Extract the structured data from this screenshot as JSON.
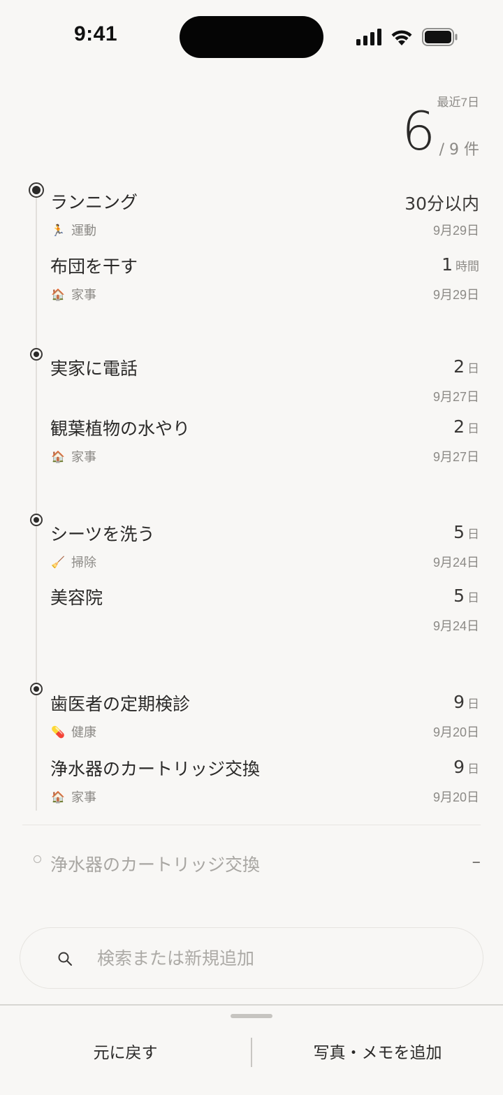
{
  "status_bar": {
    "time": "9:41",
    "icons": [
      "signal-icon",
      "wifi-icon",
      "battery-icon"
    ]
  },
  "summary": {
    "period_label": "最近7日",
    "count": "6",
    "total": "/ 9 件"
  },
  "groups": [
    {
      "items": [
        {
          "title": "ランニング",
          "category": "運動",
          "category_icon": "runner-icon",
          "emoji": "🏃",
          "duration": "30分以内",
          "unit": "",
          "date": "9月29日"
        },
        {
          "title": "布団を干す",
          "category": "家事",
          "category_icon": "house-icon",
          "emoji": "🏠",
          "duration": "1",
          "unit": "時間",
          "date": "9月29日"
        }
      ]
    },
    {
      "items": [
        {
          "title": "実家に電話",
          "category": "",
          "category_icon": "",
          "emoji": "",
          "duration": "2",
          "unit": "日",
          "date": "9月27日"
        },
        {
          "title": "観葉植物の水やり",
          "category": "家事",
          "category_icon": "house-icon",
          "emoji": "🏠",
          "duration": "2",
          "unit": "日",
          "date": "9月27日"
        }
      ]
    },
    {
      "items": [
        {
          "title": "シーツを洗う",
          "category": "掃除",
          "category_icon": "broom-icon",
          "emoji": "🧹",
          "duration": "5",
          "unit": "日",
          "date": "9月24日"
        },
        {
          "title": "美容院",
          "category": "",
          "category_icon": "",
          "emoji": "",
          "duration": "5",
          "unit": "日",
          "date": "9月24日"
        }
      ]
    },
    {
      "items": [
        {
          "title": "歯医者の定期検診",
          "category": "健康",
          "category_icon": "pill-icon",
          "emoji": "💊",
          "duration": "9",
          "unit": "日",
          "date": "9月20日"
        },
        {
          "title": "浄水器のカートリッジ交換",
          "category": "家事",
          "category_icon": "house-icon",
          "emoji": "🏠",
          "duration": "9",
          "unit": "日",
          "date": "9月20日"
        }
      ]
    }
  ],
  "pending": {
    "title": "浄水器のカートリッジ交換",
    "value": "–"
  },
  "search": {
    "placeholder": "検索または新規追加"
  },
  "bottom_bar": {
    "undo_label": "元に戻す",
    "add_label": "写真・メモを追加"
  }
}
